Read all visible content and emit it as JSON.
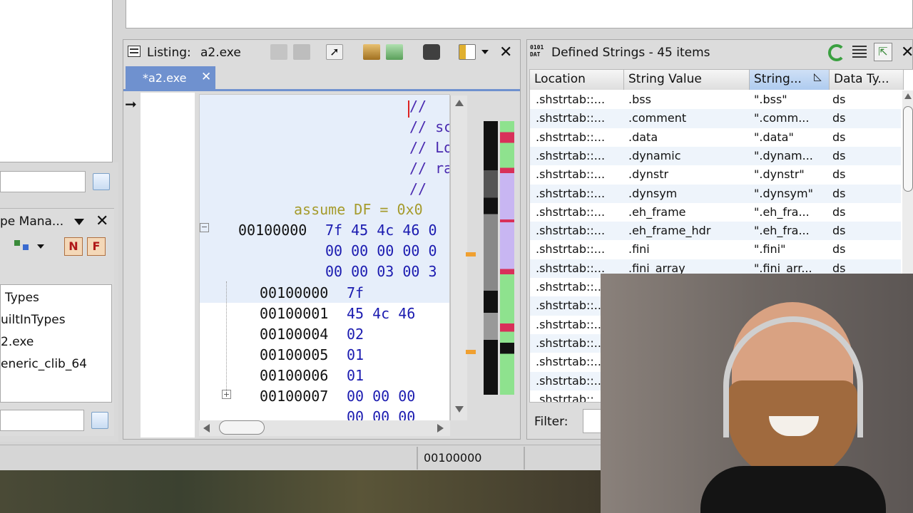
{
  "left_dock": {
    "type_manager_title": "pe Mana...",
    "tree_items": [
      "Types",
      "uiltInTypes",
      "2.exe",
      "eneric_clib_64"
    ]
  },
  "listing": {
    "title": "Listing:",
    "program": "a2.exe",
    "tab_label": "*a2.exe",
    "comments": [
      "//",
      "// sc",
      "// Lo",
      "// ra",
      "//"
    ],
    "assume_line": "assume DF = 0x0",
    "header_block": {
      "addr": "00100000",
      "lines": [
        "7f 45 4c 46 0",
        "00 00 00 00 0",
        "00 00 03 00 3"
      ]
    },
    "rows": [
      {
        "addr": "00100000",
        "bytes": "7f"
      },
      {
        "addr": "00100001",
        "bytes": "45 4c 46"
      },
      {
        "addr": "00100004",
        "bytes": "02"
      },
      {
        "addr": "00100005",
        "bytes": "01"
      },
      {
        "addr": "00100006",
        "bytes": "01"
      },
      {
        "addr": "00100007",
        "bytes": "00 00 00"
      },
      {
        "addr": "",
        "bytes": "00 00 00"
      }
    ]
  },
  "strings": {
    "title": "Defined Strings - 45 items",
    "columns": [
      "Location",
      "String Value",
      "String...",
      "Data Ty..."
    ],
    "rows": [
      {
        "location": ".shstrtab::...",
        "value": ".bss",
        "string": "\".bss\"",
        "type": "ds"
      },
      {
        "location": ".shstrtab::...",
        "value": ".comment",
        "string": "\".comm...",
        "type": "ds"
      },
      {
        "location": ".shstrtab::...",
        "value": ".data",
        "string": "\".data\"",
        "type": "ds"
      },
      {
        "location": ".shstrtab::...",
        "value": ".dynamic",
        "string": "\".dynam...",
        "type": "ds"
      },
      {
        "location": ".shstrtab::...",
        "value": ".dynstr",
        "string": "\".dynstr\"",
        "type": "ds"
      },
      {
        "location": ".shstrtab::...",
        "value": ".dynsym",
        "string": "\".dynsym\"",
        "type": "ds"
      },
      {
        "location": ".shstrtab::...",
        "value": ".eh_frame",
        "string": "\".eh_fra...",
        "type": "ds"
      },
      {
        "location": ".shstrtab::...",
        "value": ".eh_frame_hdr",
        "string": "\".eh_fra...",
        "type": "ds"
      },
      {
        "location": ".shstrtab::...",
        "value": ".fini",
        "string": "\".fini\"",
        "type": "ds"
      },
      {
        "location": ".shstrtab::...",
        "value": ".fini_array",
        "string": "\".fini_arr...",
        "type": "ds"
      },
      {
        "location": ".shstrtab::...",
        "value": "",
        "string": "",
        "type": ""
      },
      {
        "location": ".shstrtab::...",
        "value": "",
        "string": "",
        "type": ""
      },
      {
        "location": ".shstrtab::...",
        "value": "",
        "string": "",
        "type": ""
      },
      {
        "location": ".shstrtab::...",
        "value": "",
        "string": "",
        "type": ""
      },
      {
        "location": ".shstrtab::...",
        "value": "",
        "string": "",
        "type": ""
      },
      {
        "location": ".shstrtab::...",
        "value": "",
        "string": "",
        "type": ""
      },
      {
        "location": ".shstrtab::...",
        "value": "",
        "string": "",
        "type": ""
      }
    ],
    "filter_label": "Filter:"
  },
  "status": {
    "address": "00100000"
  },
  "colors": {
    "tab_active": "#6f91cf",
    "hex_text": "#1b1bb0",
    "comment_text": "#4a2ab0",
    "assume_text": "#a59b2c",
    "overview_green": "#8ee28e",
    "overview_red": "#d8305a",
    "overview_purple": "#c8b6f2"
  },
  "icons": [
    "lines-icon",
    "copy-icon",
    "paste-icon",
    "cursor-icon",
    "flow-icon",
    "navigate-icon",
    "snapshot-icon",
    "layout-icon",
    "close-icon",
    "refresh-icon",
    "table-icon",
    "export-icon",
    "data-icon",
    "filter-icon"
  ]
}
